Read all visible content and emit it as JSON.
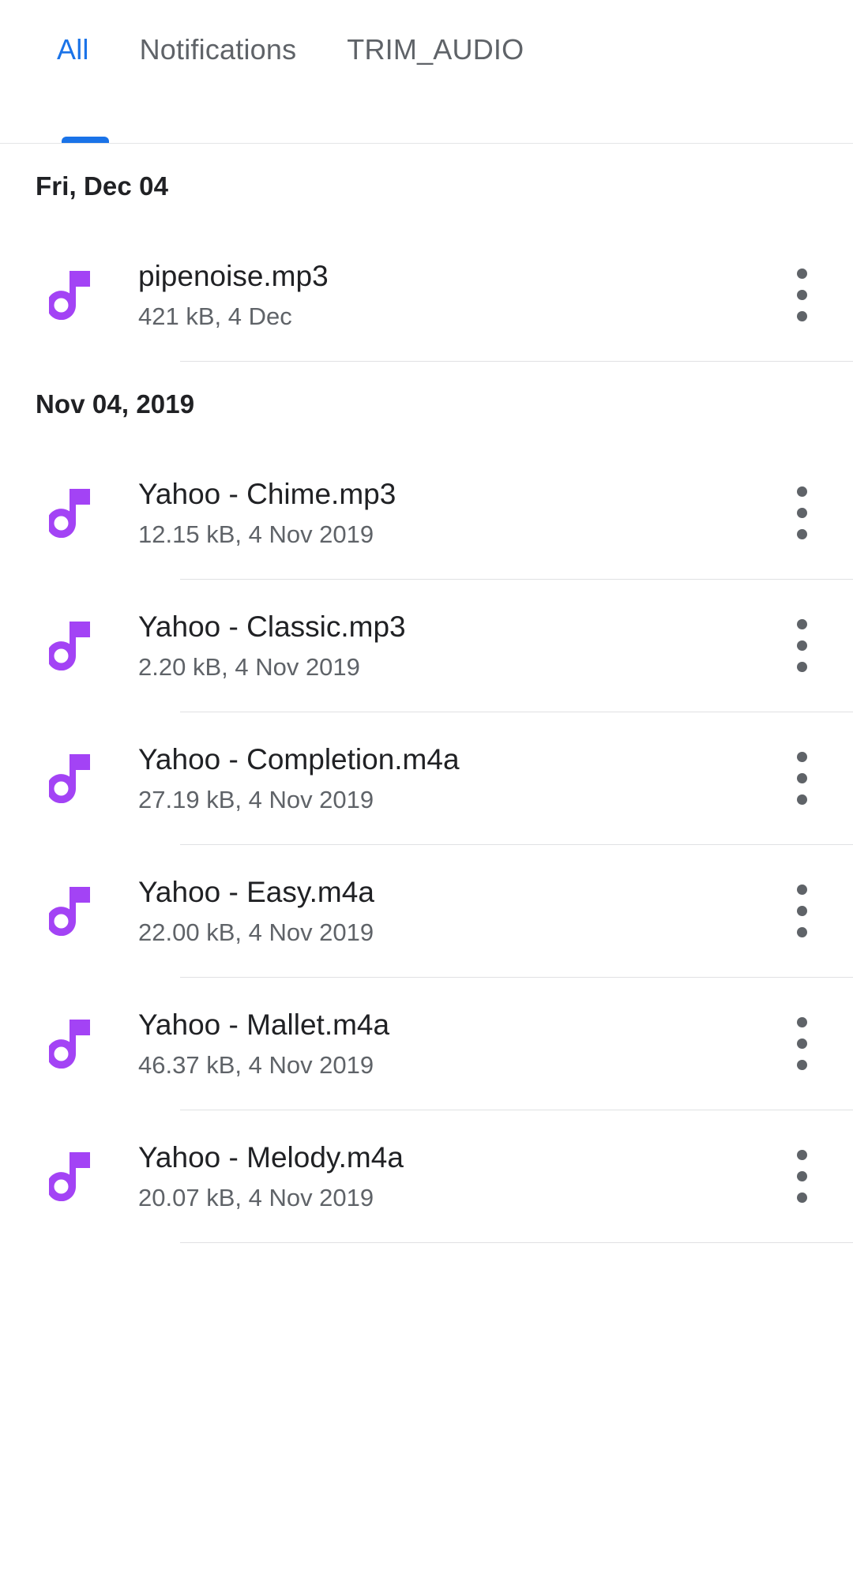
{
  "tabs": [
    {
      "label": "All",
      "active": true
    },
    {
      "label": "Notifications",
      "active": false
    },
    {
      "label": "TRIM_AUDIO",
      "active": false
    }
  ],
  "colors": {
    "accent": "#1a73e8",
    "icon_purple": "#a343f5",
    "primary_text": "#202124",
    "secondary_text": "#5f6368",
    "divider": "#e0e1e3"
  },
  "sections": [
    {
      "header": "Fri, Dec 04",
      "files": [
        {
          "icon": "music-note-icon",
          "name": "pipenoise.mp3",
          "meta": "421 kB, 4 Dec",
          "menu": "overflow-menu-icon"
        }
      ]
    },
    {
      "header": "Nov 04, 2019",
      "files": [
        {
          "icon": "music-note-icon",
          "name": "Yahoo - Chime.mp3",
          "meta": "12.15 kB, 4 Nov 2019",
          "menu": "overflow-menu-icon"
        },
        {
          "icon": "music-note-icon",
          "name": "Yahoo - Classic.mp3",
          "meta": "2.20 kB, 4 Nov 2019",
          "menu": "overflow-menu-icon"
        },
        {
          "icon": "music-note-icon",
          "name": "Yahoo - Completion.m4a",
          "meta": "27.19 kB, 4 Nov 2019",
          "menu": "overflow-menu-icon"
        },
        {
          "icon": "music-note-icon",
          "name": "Yahoo - Easy.m4a",
          "meta": "22.00 kB, 4 Nov 2019",
          "menu": "overflow-menu-icon"
        },
        {
          "icon": "music-note-icon",
          "name": "Yahoo - Mallet.m4a",
          "meta": "46.37 kB, 4 Nov 2019",
          "menu": "overflow-menu-icon"
        },
        {
          "icon": "music-note-icon",
          "name": "Yahoo - Melody.m4a",
          "meta": "20.07 kB, 4 Nov 2019",
          "menu": "overflow-menu-icon"
        }
      ]
    }
  ]
}
